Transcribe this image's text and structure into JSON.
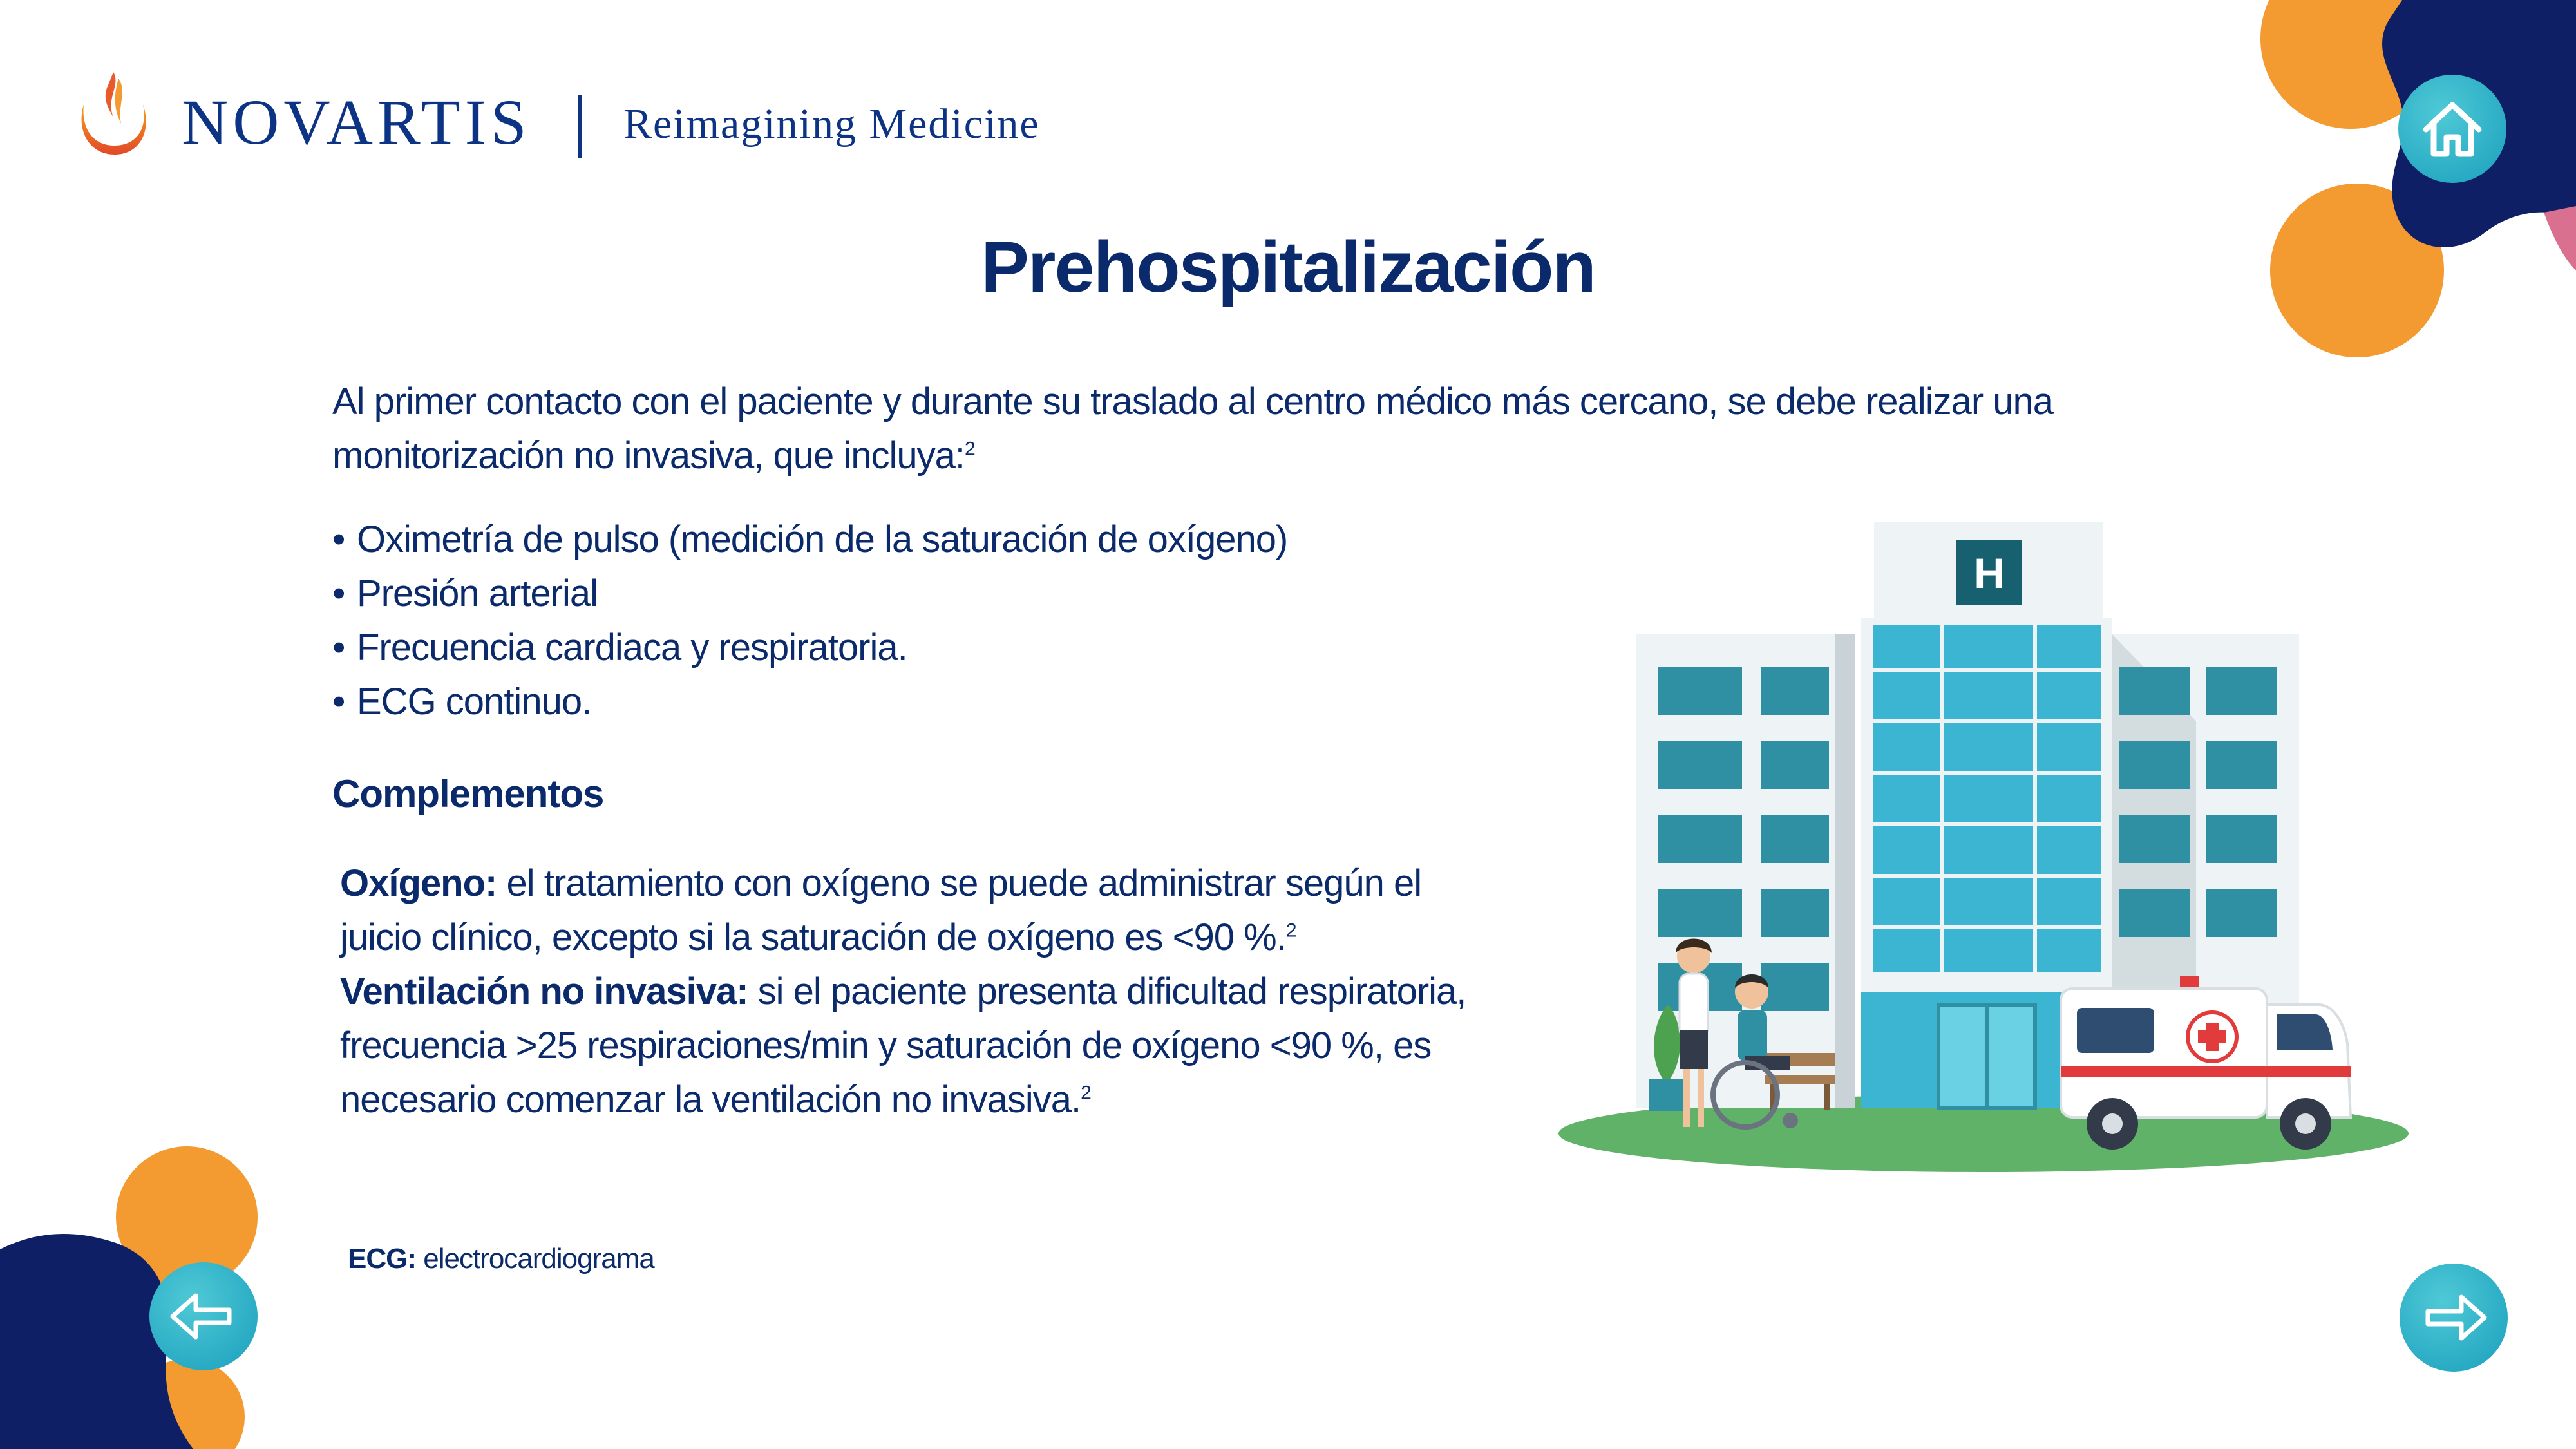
{
  "brand": {
    "name": "NOVARTIS",
    "tagline": "Reimagining Medicine"
  },
  "title": "Prehospitalización",
  "intro": {
    "text": "Al primer contacto con el paciente y durante su traslado al centro médico más cercano, se debe realizar una monitorización no invasiva, que incluya:",
    "ref": "2"
  },
  "bullets": [
    "Oximetría de pulso (medición de la saturación de oxígeno)",
    "Presión arterial",
    "Frecuencia cardiaca y respiratoria.",
    "ECG continuo."
  ],
  "complementos": {
    "heading": "Complementos",
    "oxigeno_label": "Oxígeno:",
    "oxigeno_text": " el tratamiento con oxígeno se puede administrar según el juicio clínico, excepto si la saturación de oxígeno es <90 %.",
    "oxigeno_ref": "2",
    "ventilacion_label": "Ventilación no invasiva:",
    "ventilacion_text": " si el paciente presenta dificultad respiratoria, frecuencia >25 respiraciones/min y saturación de oxígeno <90 %, es necesario comenzar la ventilación no invasiva.",
    "ventilacion_ref": "2"
  },
  "footnote": {
    "abbr": "ECG:",
    "text": " electrocardiograma"
  },
  "illustration": {
    "hospital_sign": "H"
  },
  "icons": {
    "home": "home-icon",
    "back": "arrow-left-icon",
    "next": "arrow-right-icon"
  },
  "colors": {
    "navy": "#0b2a6b",
    "orange": "#f39a31",
    "teal": "#1a9fbd",
    "pink": "#d9708f"
  }
}
